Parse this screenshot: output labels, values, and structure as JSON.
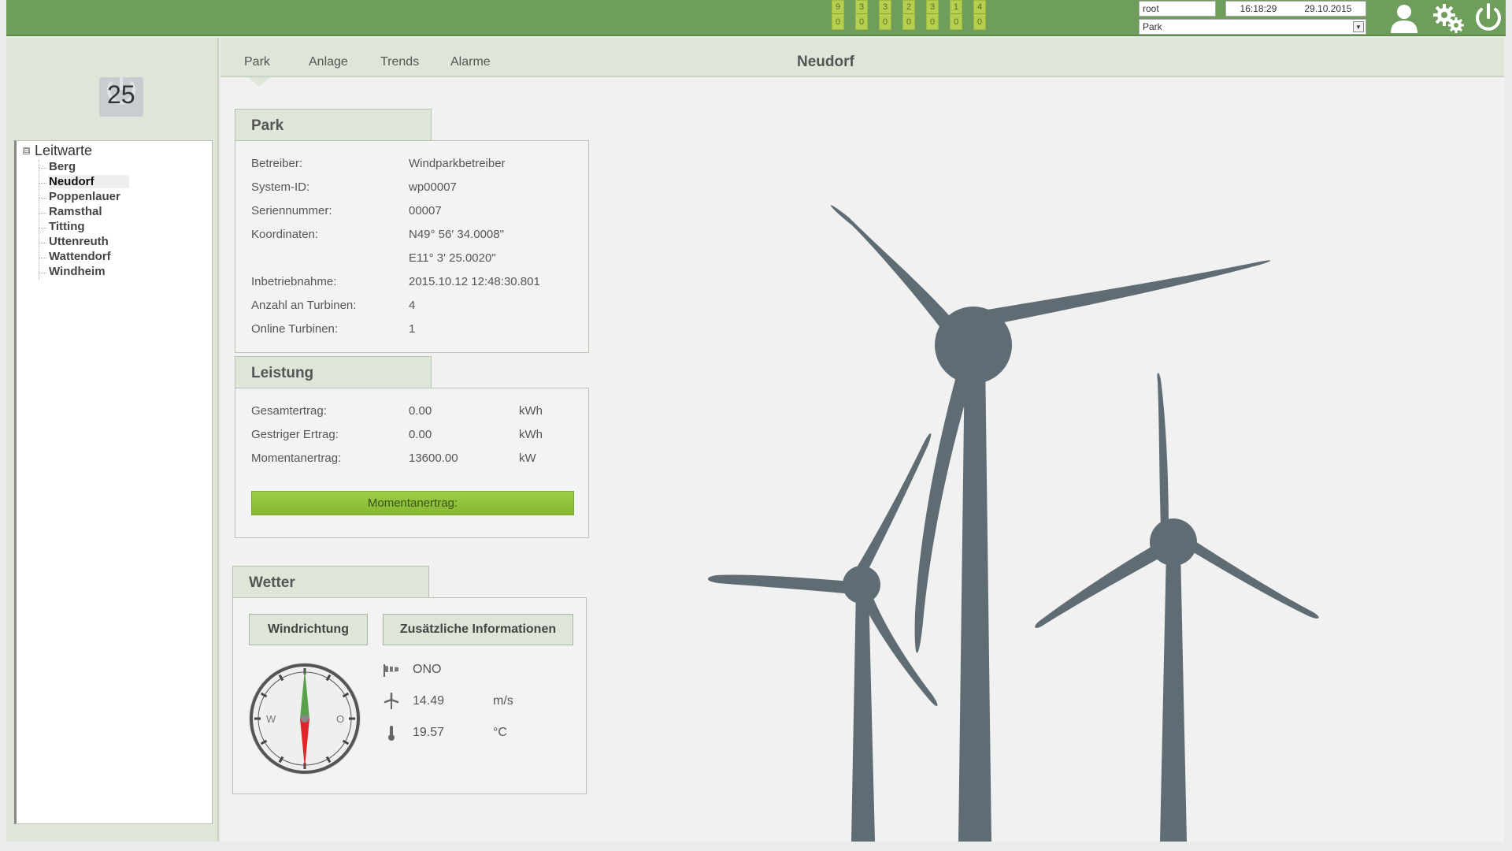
{
  "topbar": {
    "counters": [
      {
        "top": "9",
        "bottom": "0"
      },
      {
        "top": "3",
        "bottom": "0"
      },
      {
        "top": "3",
        "bottom": "0"
      },
      {
        "top": "2",
        "bottom": "0"
      },
      {
        "top": "3",
        "bottom": "0"
      },
      {
        "top": "1",
        "bottom": "0"
      },
      {
        "top": "4",
        "bottom": "0"
      }
    ],
    "user": "root",
    "time": "16:18:29",
    "date": "29.10.2015",
    "park_select": "Park",
    "icons": [
      "user-icon",
      "settings-icon",
      "power-icon"
    ]
  },
  "sidebar": {
    "alarm_count": "25",
    "tree": {
      "root": "Leitwarte",
      "expander": "⊟",
      "items": [
        "Berg",
        "Neudorf",
        "Poppenlauer",
        "Ramsthal",
        "Titting",
        "Uttenreuth",
        "Wattendorf",
        "Windheim"
      ],
      "selected": "Neudorf"
    }
  },
  "tabs": [
    "Park",
    "Anlage",
    "Trends",
    "Alarme"
  ],
  "page_title": "Neudorf",
  "park_panel": {
    "title": "Park",
    "rows": [
      {
        "label": "Betreiber:",
        "value": "Windparkbetreiber"
      },
      {
        "label": "System-ID:",
        "value": "wp00007"
      },
      {
        "label": "Seriennummer:",
        "value": "00007"
      },
      {
        "label": "Koordinaten:",
        "value": "N49° 56' 34.0008\""
      },
      {
        "label": "",
        "value": "E11° 3' 25.0020\""
      },
      {
        "label": "Inbetriebnahme:",
        "value": "2015.10.12 12:48:30.801"
      },
      {
        "label": "Anzahl an Turbinen:",
        "value": "4"
      },
      {
        "label": "Online Turbinen:",
        "value": "1"
      }
    ]
  },
  "power_panel": {
    "title": "Leistung",
    "rows": [
      {
        "label": "Gesamtertrag:",
        "value": "0.00",
        "unit": "kWh"
      },
      {
        "label": "Gestriger Ertrag:",
        "value": "0.00",
        "unit": "kWh"
      },
      {
        "label": "Momentanertrag:",
        "value": "13600.00",
        "unit": "kW"
      }
    ],
    "bar_label": "Momentanertrag:"
  },
  "weather_panel": {
    "title": "Wetter",
    "btn_wind": "Windrichtung",
    "btn_info": "Zusätzliche Informationen",
    "compass": {
      "west": "W",
      "east": "O"
    },
    "direction": "ONO",
    "wind_speed": "14.49",
    "wind_unit": "m/s",
    "temperature": "19.57",
    "temp_unit": "°C"
  },
  "colors": {
    "topbar": "#6f9e5c",
    "accent_green": "#8fc23d",
    "turbine": "#5f6c74"
  }
}
